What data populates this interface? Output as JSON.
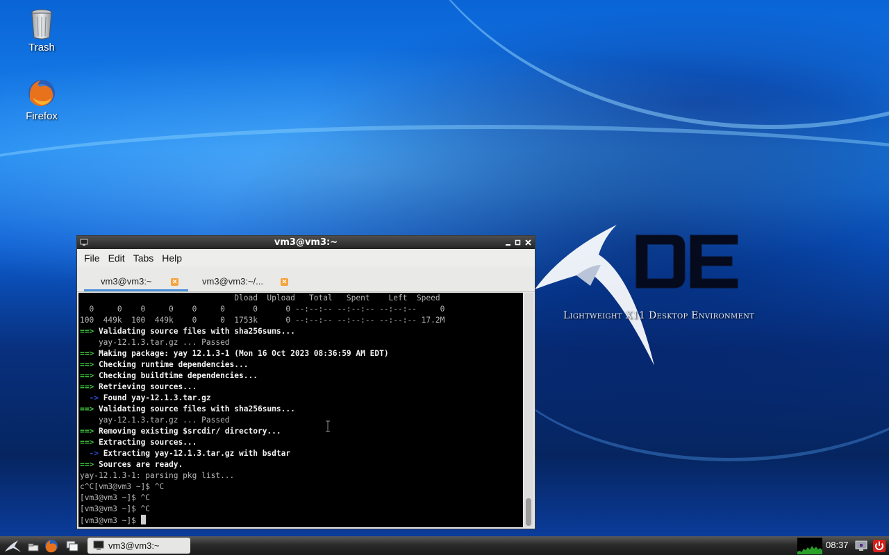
{
  "desktop": {
    "icons": [
      {
        "label": "Trash",
        "icon": "trash-icon"
      },
      {
        "label": "Firefox",
        "icon": "firefox-icon"
      }
    ],
    "wallpaper": {
      "logo_text": "DE",
      "tagline": "Lightweight X11 Desktop Environment"
    }
  },
  "window": {
    "title": "vm3@vm3:~",
    "controls": {
      "minimize": "‗",
      "maximize": "□",
      "close": "×"
    },
    "menu": [
      "File",
      "Edit",
      "Tabs",
      "Help"
    ],
    "tabs": [
      {
        "label": "vm3@vm3:~",
        "active": true
      },
      {
        "label": "vm3@vm3:~/...",
        "active": false
      }
    ],
    "terminal_lines": [
      [
        {
          "c": "d",
          "t": "                                 Dload  Upload   Total   Spent    Left  Speed"
        }
      ],
      [
        {
          "c": "d",
          "t": "  0     0    0     0    0     0      0      0 --:--:-- --:--:-- --:--:--     0"
        }
      ],
      [
        {
          "c": "d",
          "t": "100  449k  100  449k    0     0  1753k      0 --:--:-- --:--:-- --:--:-- 17.2M"
        }
      ],
      [
        {
          "c": "g",
          "t": "==> "
        },
        {
          "c": "w",
          "t": "Validating source files with sha256sums..."
        }
      ],
      [
        {
          "c": "d",
          "t": "    yay-12.1.3.tar.gz ... Passed"
        }
      ],
      [
        {
          "c": "g",
          "t": "==> "
        },
        {
          "c": "w",
          "t": "Making package: yay 12.1.3-1 (Mon 16 Oct 2023 08:36:59 AM EDT)"
        }
      ],
      [
        {
          "c": "g",
          "t": "==> "
        },
        {
          "c": "w",
          "t": "Checking runtime dependencies..."
        }
      ],
      [
        {
          "c": "g",
          "t": "==> "
        },
        {
          "c": "w",
          "t": "Checking buildtime dependencies..."
        }
      ],
      [
        {
          "c": "g",
          "t": "==> "
        },
        {
          "c": "w",
          "t": "Retrieving sources..."
        }
      ],
      [
        {
          "c": "b",
          "t": "  -> "
        },
        {
          "c": "w",
          "t": "Found yay-12.1.3.tar.gz"
        }
      ],
      [
        {
          "c": "g",
          "t": "==> "
        },
        {
          "c": "w",
          "t": "Validating source files with sha256sums..."
        }
      ],
      [
        {
          "c": "d",
          "t": "    yay-12.1.3.tar.gz ... Passed"
        }
      ],
      [
        {
          "c": "g",
          "t": "==> "
        },
        {
          "c": "w",
          "t": "Removing existing $srcdir/ directory..."
        }
      ],
      [
        {
          "c": "g",
          "t": "==> "
        },
        {
          "c": "w",
          "t": "Extracting sources..."
        }
      ],
      [
        {
          "c": "b",
          "t": "  -> "
        },
        {
          "c": "w",
          "t": "Extracting yay-12.1.3.tar.gz with bsdtar"
        }
      ],
      [
        {
          "c": "g",
          "t": "==> "
        },
        {
          "c": "w",
          "t": "Sources are ready."
        }
      ],
      [
        {
          "c": "d",
          "t": "yay-12.1.3-1: parsing pkg list..."
        }
      ],
      [
        {
          "c": "d",
          "t": "c^C[vm3@vm3 ~]$ ^C"
        }
      ],
      [
        {
          "c": "d",
          "t": "[vm3@vm3 ~]$ ^C"
        }
      ],
      [
        {
          "c": "d",
          "t": "[vm3@vm3 ~]$ ^C"
        }
      ],
      [
        {
          "c": "d",
          "t": "[vm3@vm3 ~]$ "
        }
      ]
    ]
  },
  "panel": {
    "task_button": "vm3@vm3:~",
    "clock": "08:37"
  }
}
